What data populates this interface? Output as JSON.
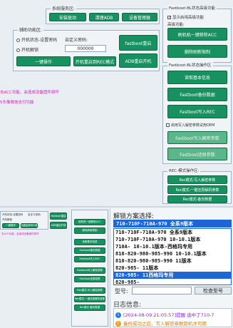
{
  "system_service": {
    "title": "系统服务区:",
    "install_driver": "安装驱动",
    "clear_adb": "清理ADB",
    "device_manager": "设备管理器"
  },
  "aux_function": {
    "title": "辅助功能区:",
    "custom_password_label": "自定义密码:",
    "mode_ops_no_setting_password": "开机状态-设置密码",
    "mode_boot_unlock": "开机解锁",
    "password_value": "000000",
    "one_click_op": "一键操作",
    "reboot_rec_mode": "开机重启到REC模式",
    "fastboot_reboot": "fastboot重启",
    "adb_reboot": "ADB重启开机"
  },
  "fastboot_special": {
    "title": "Fastboot-BL状态高级功能",
    "reflash_opt": "显示启用高级功能",
    "advanced_label": "高级功能:",
    "unlock_acc": "刷机机一键移除ACC",
    "remove_limit": "删除刷新限制"
  },
  "fastboot_ops": {
    "title": "Fastboot-BL状态操作区",
    "read_info": "读取基本信息",
    "backup_data": "Fastboot备份数据",
    "write_rec": "Fastboot写入REC",
    "enable_writing_label": "启用写入解密参数试用OEM",
    "write_unlock": "Fastboot写入解密参数",
    "restore_params": "Fastboot还原参数"
  },
  "rec_ops": {
    "title": "REC-模式操作区:",
    "rec_write_unlock": "Rec模式-写入解密参数",
    "rec_restore": "Rec模式-一键还原解机参数",
    "rec_backup": "Rec模式-备份数据"
  },
  "notes": {
    "line1": "去ACC功能，会造成设备固件损坏",
    "line2": "5头像微信支付功能"
  },
  "unlock_scheme": {
    "title": "解锁方案选择:",
    "selected_value": "710-710F-710A-970        全系9版本",
    "options": [
      "710-710F-710A-970        全系9版本",
      "710-710F-710A-970         10-10.1版本",
      "710A-        10-10.1版本-西格玛专用",
      "810-820-980-985-990  10-10.1版本",
      "810-820-980-985-990      11版本",
      "820-985-                11版本",
      "820-985-         11西格玛专用",
      "820-985-"
    ],
    "selected_index": 6,
    "model_label": "型号:",
    "check_model_btn": "检查型号"
  },
  "log": {
    "title": "日志信息:",
    "line1": "[2024-08-09 21:05:57]提醒 选中了710-7",
    "line2": "备份成功之后，写入解密参数锁机才可用"
  },
  "colors": {
    "green": "#17915f",
    "pink": "#d21fbd",
    "selection": "#1f64d8"
  }
}
